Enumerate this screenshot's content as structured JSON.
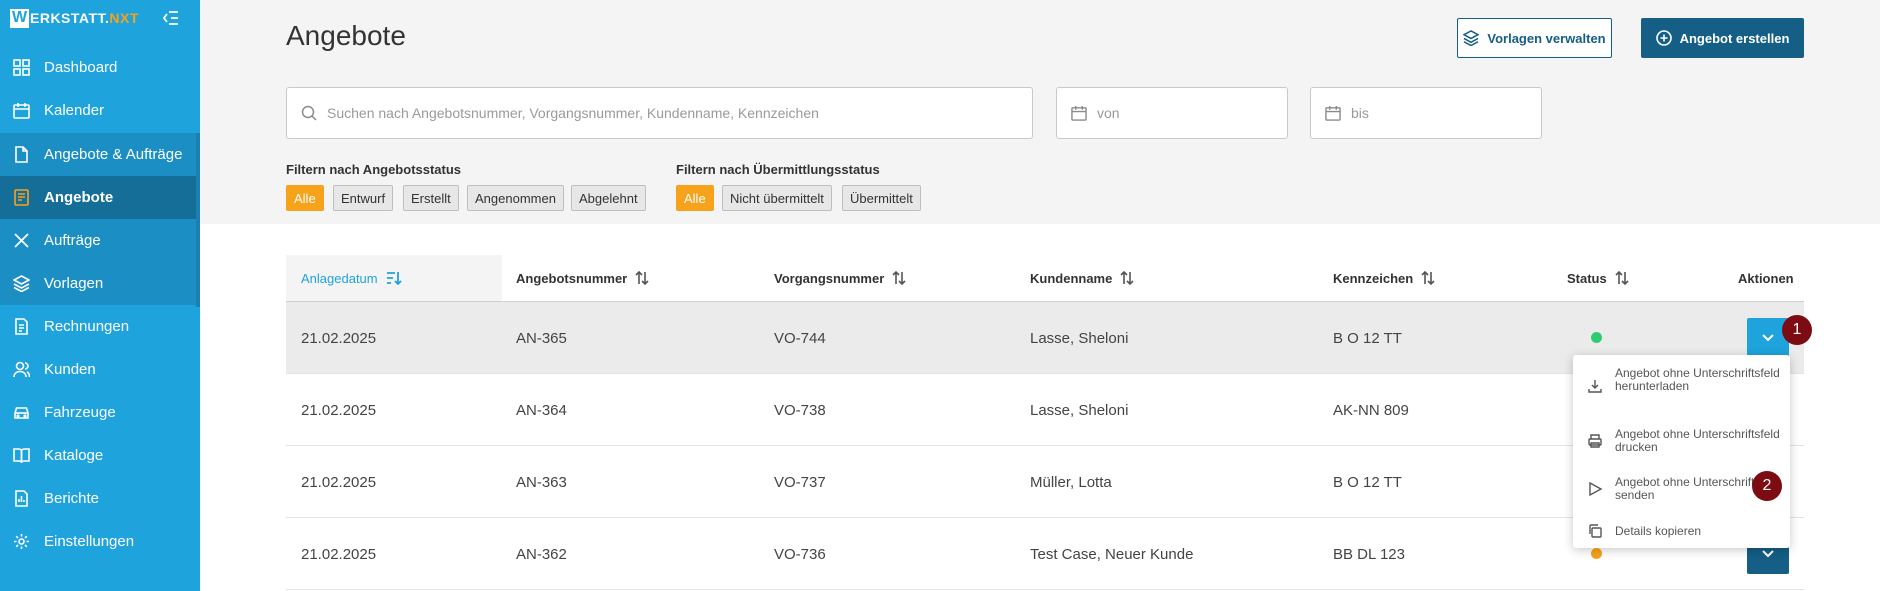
{
  "app": {
    "logo_main": "WERKSTATT.",
    "logo_accent": "NXT",
    "logo_letter": "W"
  },
  "sidebar": {
    "items": [
      {
        "label": "Dashboard",
        "icon": "dashboard-icon"
      },
      {
        "label": "Kalender",
        "icon": "calendar-icon"
      },
      {
        "label": "Angebote & Aufträge",
        "icon": "document-icon"
      },
      {
        "label": "Angebote",
        "icon": "offer-icon"
      },
      {
        "label": "Aufträge",
        "icon": "tools-icon"
      },
      {
        "label": "Vorlagen",
        "icon": "layers-icon"
      },
      {
        "label": "Rechnungen",
        "icon": "invoice-icon"
      },
      {
        "label": "Kunden",
        "icon": "users-icon"
      },
      {
        "label": "Fahrzeuge",
        "icon": "car-icon"
      },
      {
        "label": "Kataloge",
        "icon": "book-icon"
      },
      {
        "label": "Berichte",
        "icon": "report-icon"
      },
      {
        "label": "Einstellungen",
        "icon": "gear-icon"
      }
    ]
  },
  "header": {
    "title": "Angebote",
    "manage_templates_label": "Vorlagen verwalten",
    "create_offer_label": "Angebot erstellen"
  },
  "search": {
    "placeholder": "Suchen nach Angebotsnummer, Vorgangsnummer, Kundenname, Kennzeichen"
  },
  "date_filter": {
    "from_placeholder": "von",
    "to_placeholder": "bis"
  },
  "filters": {
    "offer_status_label": "Filtern nach Angebotsstatus",
    "offer_status": [
      "Alle",
      "Entwurf",
      "Erstellt",
      "Angenommen",
      "Abgelehnt"
    ],
    "transmission_status_label": "Filtern nach Übermittlungsstatus",
    "transmission_status": [
      "Alle",
      "Nicht übermittelt",
      "Übermittelt"
    ],
    "active_color": "#f7a21b"
  },
  "table": {
    "columns": [
      "Anlagedatum",
      "Angebotsnummer",
      "Vorgangsnummer",
      "Kundenname",
      "Kennzeichen",
      "Status",
      "Aktionen"
    ],
    "rows": [
      {
        "date": "21.02.2025",
        "offer": "AN-365",
        "process": "VO-744",
        "customer": "Lasse, Sheloni",
        "plate": "B O 12 TT",
        "status_color": "#2ecc71"
      },
      {
        "date": "21.02.2025",
        "offer": "AN-364",
        "process": "VO-738",
        "customer": "Lasse, Sheloni",
        "plate": "AK-NN 809",
        "status_color": ""
      },
      {
        "date": "21.02.2025",
        "offer": "AN-363",
        "process": "VO-737",
        "customer": "Müller, Lotta",
        "plate": "B O 12 TT",
        "status_color": ""
      },
      {
        "date": "21.02.2025",
        "offer": "AN-362",
        "process": "VO-736",
        "customer": "Test Case, Neuer Kunde",
        "plate": "BB DL 123",
        "status_color": "#f7a21b"
      }
    ]
  },
  "dropdown": {
    "items": [
      {
        "label": "Angebot ohne Unterschriftsfeld herunterladen",
        "icon": "download-icon"
      },
      {
        "label": "Angebot ohne Unterschriftsfeld drucken",
        "icon": "printer-icon"
      },
      {
        "label": "Angebot ohne Unterschriftsfeld senden",
        "icon": "send-icon"
      },
      {
        "label": "Details kopieren",
        "icon": "copy-icon"
      }
    ]
  },
  "badges": [
    "1",
    "2"
  ],
  "colors": {
    "sidebar": "#1fa3dc",
    "sidebar_active": "#156e98",
    "primary": "#155e86",
    "accent": "#f7a21b",
    "badge": "#7d0b12"
  }
}
